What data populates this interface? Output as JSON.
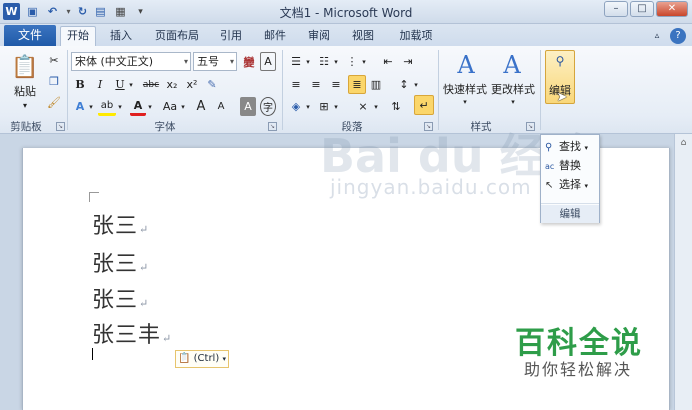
{
  "window": {
    "title": "文档1 - Microsoft Word",
    "controls": [
      "–",
      "□",
      "✕"
    ]
  },
  "tabs": {
    "file": "文件",
    "items": [
      "开始",
      "插入",
      "页面布局",
      "引用",
      "邮件",
      "审阅",
      "视图",
      "加载项"
    ],
    "active": "开始"
  },
  "ribbon": {
    "clipboard": {
      "label": "剪贴板",
      "paste": "粘贴"
    },
    "font": {
      "label": "字体",
      "font_name": "宋体 (中文正文)",
      "font_size": "五号",
      "buttons": [
        "B",
        "I",
        "U",
        "abc",
        "x₂",
        "x²",
        "A",
        "A",
        "Aa",
        "A",
        "A",
        "A",
        "字"
      ]
    },
    "paragraph": {
      "label": "段落"
    },
    "styles": {
      "label": "样式",
      "quick_styles": "快速样式",
      "change_styles": "更改样式"
    },
    "editing": {
      "label": "编辑"
    }
  },
  "edit_menu": {
    "items": [
      {
        "label": "查找",
        "has_arrow": true
      },
      {
        "label": "替换",
        "has_arrow": false
      },
      {
        "label": "选择",
        "has_arrow": true
      }
    ],
    "footer": "编辑"
  },
  "document": {
    "lines": [
      "张三",
      "张三",
      "张三",
      "张三丰"
    ],
    "paragraph_mark": "↵",
    "paste_options": "(Ctrl)"
  },
  "watermark": {
    "brand": "Bai du 经验",
    "url": "jingyan.baidu.com",
    "main": "百科全说",
    "sub": "助你轻松解决"
  },
  "colors": {
    "file_tab": "#2a64b2",
    "font_color_red": "#e02020",
    "highlight_yellow": "#ffea00",
    "watermark_green": "#2e9d49"
  }
}
